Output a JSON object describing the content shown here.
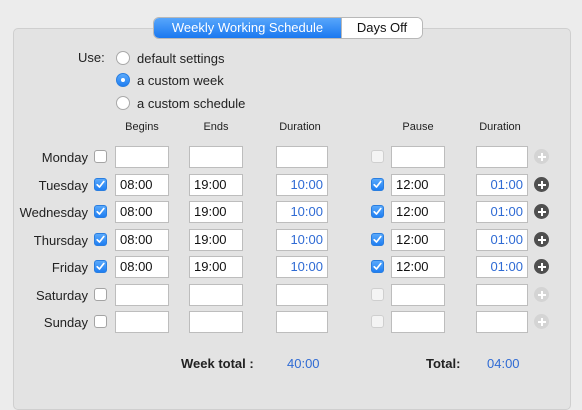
{
  "tabs": [
    {
      "label": "Weekly Working Schedule",
      "selected": true
    },
    {
      "label": "Days Off",
      "selected": false
    }
  ],
  "use": {
    "label": "Use:",
    "options": [
      {
        "label": "default settings",
        "selected": false
      },
      {
        "label": "a custom week",
        "selected": true
      },
      {
        "label": "a custom schedule",
        "selected": false
      }
    ]
  },
  "headers": {
    "begins": "Begins",
    "ends": "Ends",
    "duration": "Duration",
    "pause": "Pause",
    "pause_duration": "Duration"
  },
  "days": [
    {
      "name": "Monday",
      "enabled": false,
      "begins": "",
      "ends": "",
      "duration": "",
      "pause_enabled": false,
      "pause": "",
      "pause_duration": ""
    },
    {
      "name": "Tuesday",
      "enabled": true,
      "begins": "08:00",
      "ends": "19:00",
      "duration": "10:00",
      "pause_enabled": true,
      "pause": "12:00",
      "pause_duration": "01:00"
    },
    {
      "name": "Wednesday",
      "enabled": true,
      "begins": "08:00",
      "ends": "19:00",
      "duration": "10:00",
      "pause_enabled": true,
      "pause": "12:00",
      "pause_duration": "01:00"
    },
    {
      "name": "Thursday",
      "enabled": true,
      "begins": "08:00",
      "ends": "19:00",
      "duration": "10:00",
      "pause_enabled": true,
      "pause": "12:00",
      "pause_duration": "01:00"
    },
    {
      "name": "Friday",
      "enabled": true,
      "begins": "08:00",
      "ends": "19:00",
      "duration": "10:00",
      "pause_enabled": true,
      "pause": "12:00",
      "pause_duration": "01:00"
    },
    {
      "name": "Saturday",
      "enabled": false,
      "begins": "",
      "ends": "",
      "duration": "",
      "pause_enabled": false,
      "pause": "",
      "pause_duration": ""
    },
    {
      "name": "Sunday",
      "enabled": false,
      "begins": "",
      "ends": "",
      "duration": "",
      "pause_enabled": false,
      "pause": "",
      "pause_duration": ""
    }
  ],
  "totals": {
    "week_label": "Week total :",
    "week_value": "40:00",
    "total_label": "Total:",
    "total_value": "04:00"
  },
  "colors": {
    "accent": "#1f7ef2",
    "duration_text": "#2f6bd4"
  },
  "icons": {
    "add": "plus-circle-icon",
    "check": "checkmark-icon"
  }
}
